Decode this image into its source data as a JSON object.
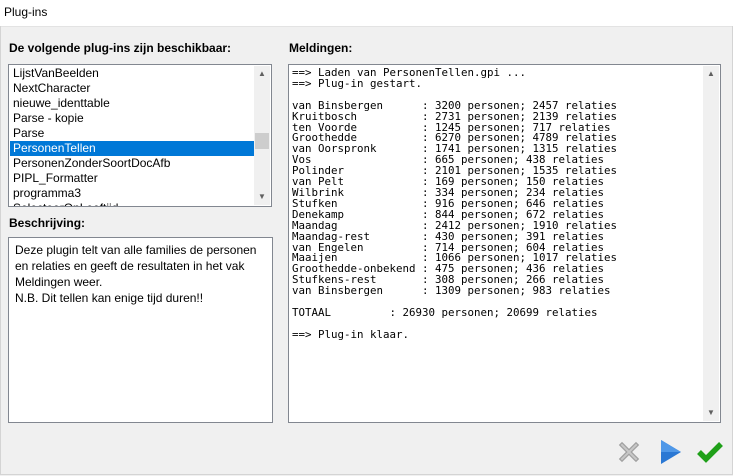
{
  "window": {
    "title": "Plug-ins"
  },
  "plugins": {
    "label": "De volgende plug-ins zijn beschikbaar:",
    "items": [
      "LijstVanBeelden",
      "NextCharacter",
      "nieuwe_identtable",
      "Parse - kopie",
      "Parse",
      "PersonenTellen",
      "PersonenZonderSoortDocAfb",
      "PIPL_Formatter",
      "programma3",
      "SelecteerOnLeeftijd"
    ],
    "selected_item": "PersonenTellen"
  },
  "description": {
    "label": "Beschrijving:",
    "lines": [
      "Deze plugin telt van alle families de personen",
      "en relaties en geeft de resultaten in het vak",
      "Meldingen weer.",
      "N.B. Dit tellen kan enige tijd duren!!"
    ]
  },
  "messages": {
    "label": "Meldingen:",
    "lines": [
      "==> Laden van PersonenTellen.gpi ...",
      "==> Plug-in gestart.",
      "",
      "van Binsbergen      : 3200 personen; 2457 relaties",
      "Kruitbosch          : 2731 personen; 2139 relaties",
      "ten Voorde          : 1245 personen; 717 relaties",
      "Groothedde          : 6270 personen; 4789 relaties",
      "van Oorspronk       : 1741 personen; 1315 relaties",
      "Vos                 : 665 personen; 438 relaties",
      "Polinder            : 2101 personen; 1535 relaties",
      "van Pelt            : 169 personen; 150 relaties",
      "Wilbrink            : 334 personen; 234 relaties",
      "Stufken             : 916 personen; 646 relaties",
      "Denekamp            : 844 personen; 672 relaties",
      "Maandag             : 2412 personen; 1910 relaties",
      "Maandag-rest        : 430 personen; 391 relaties",
      "van Engelen         : 714 personen; 604 relaties",
      "Maaijen             : 1066 personen; 1017 relaties",
      "Groothedde-onbekend : 475 personen; 436 relaties",
      "Stufkens-rest       : 308 personen; 266 relaties",
      "van Binsbergen      : 1309 personen; 983 relaties",
      "",
      "TOTAAL         : 26930 personen; 20699 relaties",
      "",
      "==> Plug-in klaar."
    ]
  },
  "buttons": {
    "cancel": {
      "icon": "x-icon",
      "enabled": false
    },
    "run": {
      "icon": "play-icon",
      "enabled": true
    },
    "ok": {
      "icon": "checkmark-icon",
      "enabled": true
    }
  },
  "colors": {
    "selection": "#0078d7",
    "run_icon": "#2a78d4",
    "ok_icon": "#1fa019",
    "cancel_icon_disabled": "#a0a0a0"
  }
}
